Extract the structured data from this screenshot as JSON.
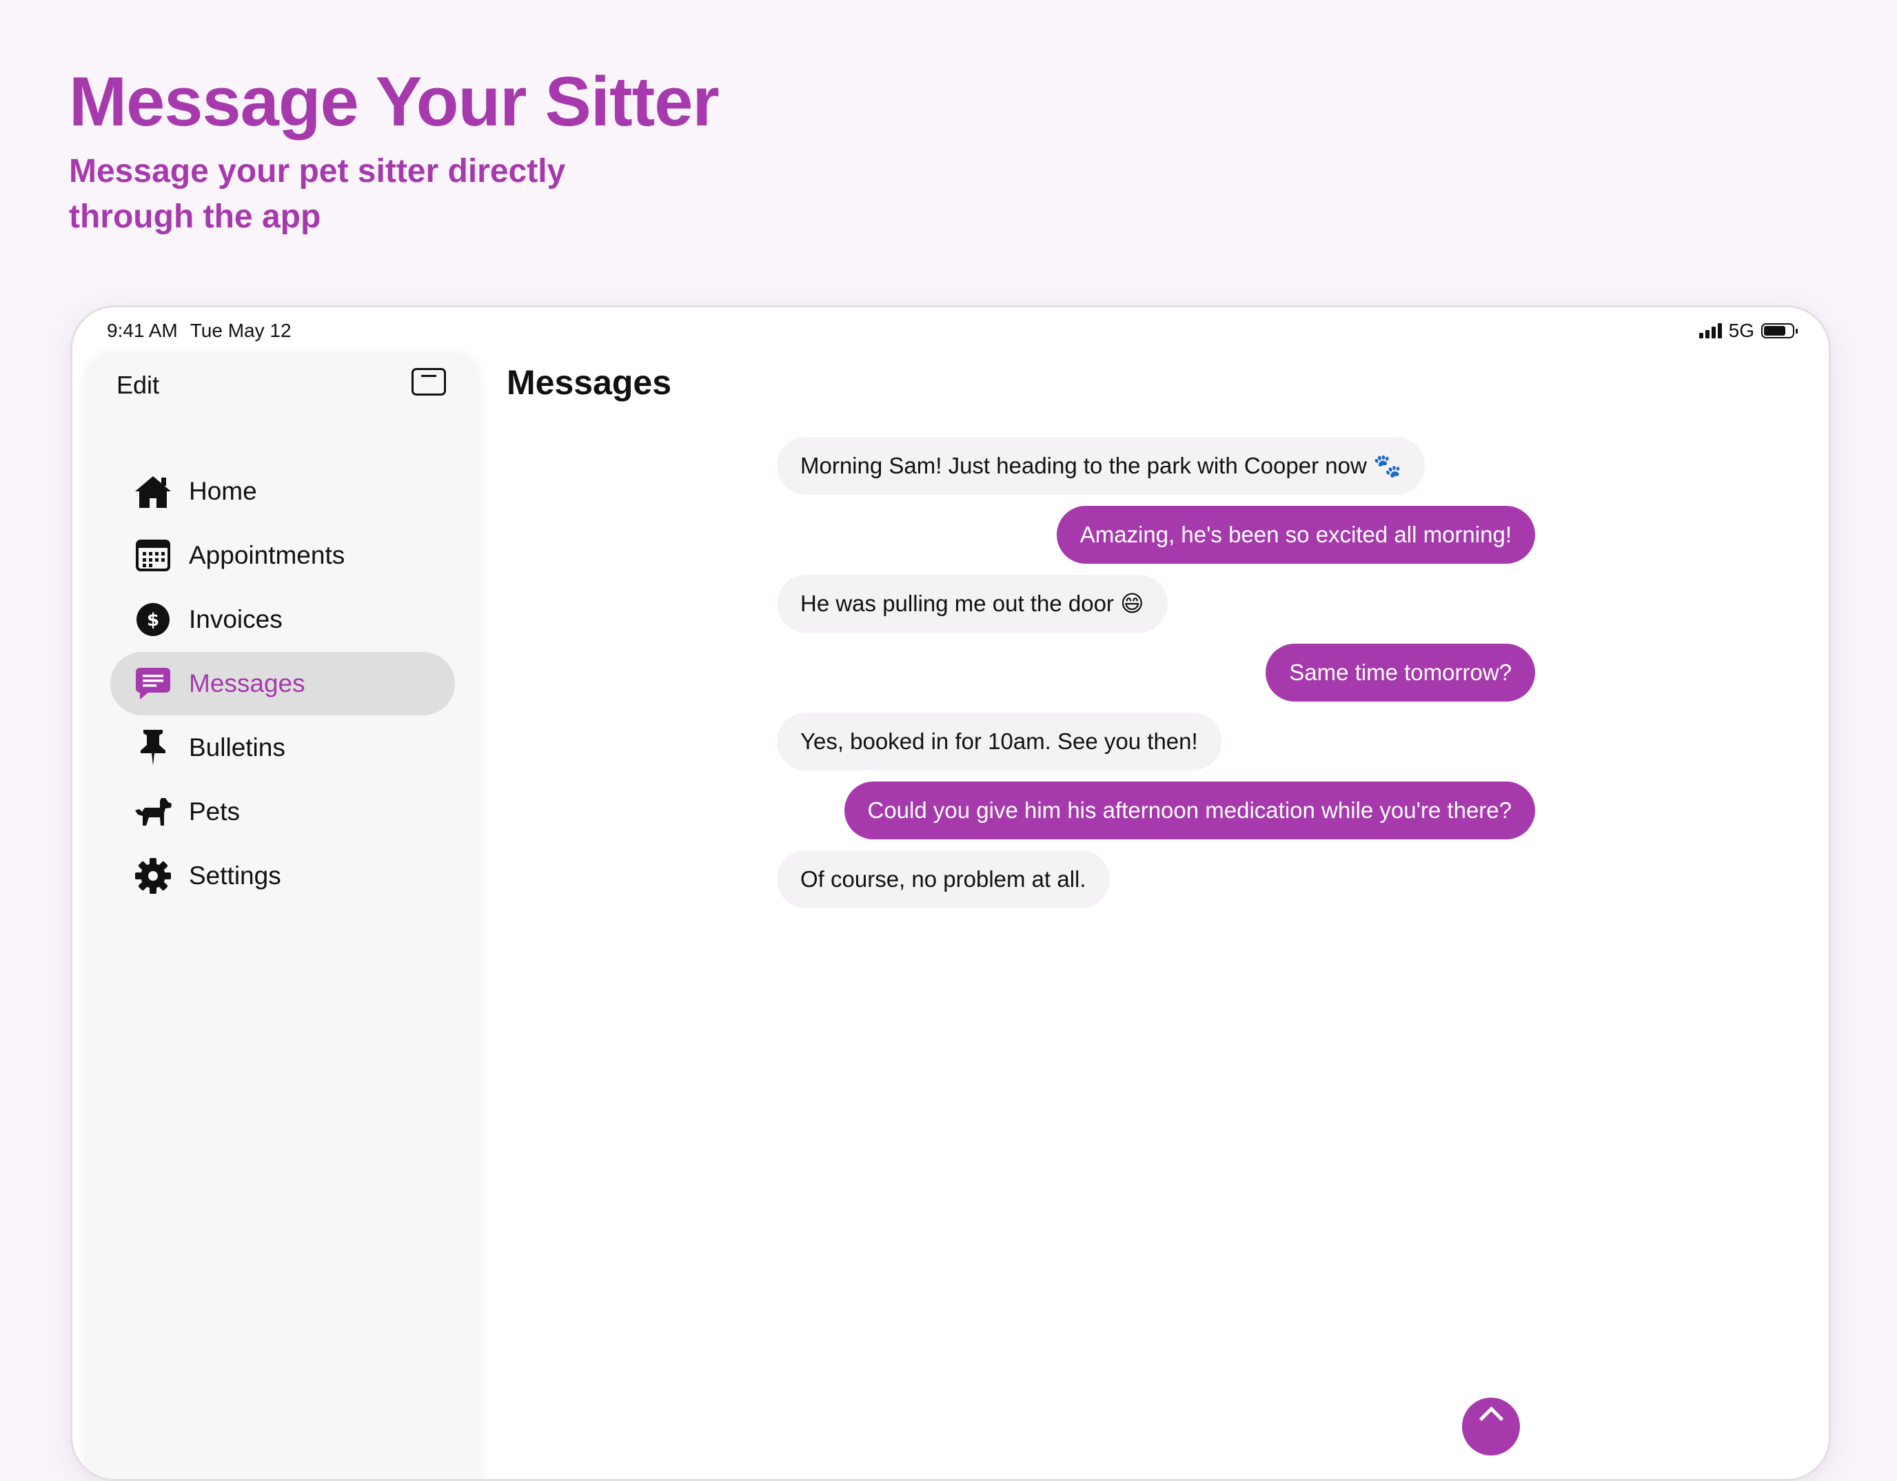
{
  "hero": {
    "title": "Message Your Sitter",
    "subtitle": "Message your pet sitter directly through the app"
  },
  "status_bar": {
    "time": "9:41 AM",
    "date": "Tue May 12",
    "network": "5G"
  },
  "sidebar": {
    "edit_label": "Edit",
    "items": [
      {
        "label": "Home",
        "icon": "house-icon",
        "active": false
      },
      {
        "label": "Appointments",
        "icon": "calendar-icon",
        "active": false
      },
      {
        "label": "Invoices",
        "icon": "dollar-circle-icon",
        "active": false
      },
      {
        "label": "Messages",
        "icon": "message-bubble-icon",
        "active": true
      },
      {
        "label": "Bulletins",
        "icon": "pin-icon",
        "active": false
      },
      {
        "label": "Pets",
        "icon": "dog-icon",
        "active": false
      },
      {
        "label": "Settings",
        "icon": "gear-icon",
        "active": false
      }
    ]
  },
  "main": {
    "title": "Messages",
    "messages": [
      {
        "text": "Morning Sam! Just heading to the park with Cooper now 🐾",
        "direction": "incoming"
      },
      {
        "text": "Amazing, he's been so excited all morning!",
        "direction": "outgoing"
      },
      {
        "text": "He was pulling me out the door 😄",
        "direction": "incoming"
      },
      {
        "text": "Same time tomorrow?",
        "direction": "outgoing"
      },
      {
        "text": "Yes, booked in for 10am. See you then!",
        "direction": "incoming"
      },
      {
        "text": "Could you give him his afternoon medication while you're there?",
        "direction": "outgoing"
      },
      {
        "text": "Of course, no problem at all.",
        "direction": "incoming"
      }
    ]
  },
  "colors": {
    "accent": "#a63aad",
    "background": "#faf5fb",
    "incoming_bubble": "#f4f2f4"
  }
}
